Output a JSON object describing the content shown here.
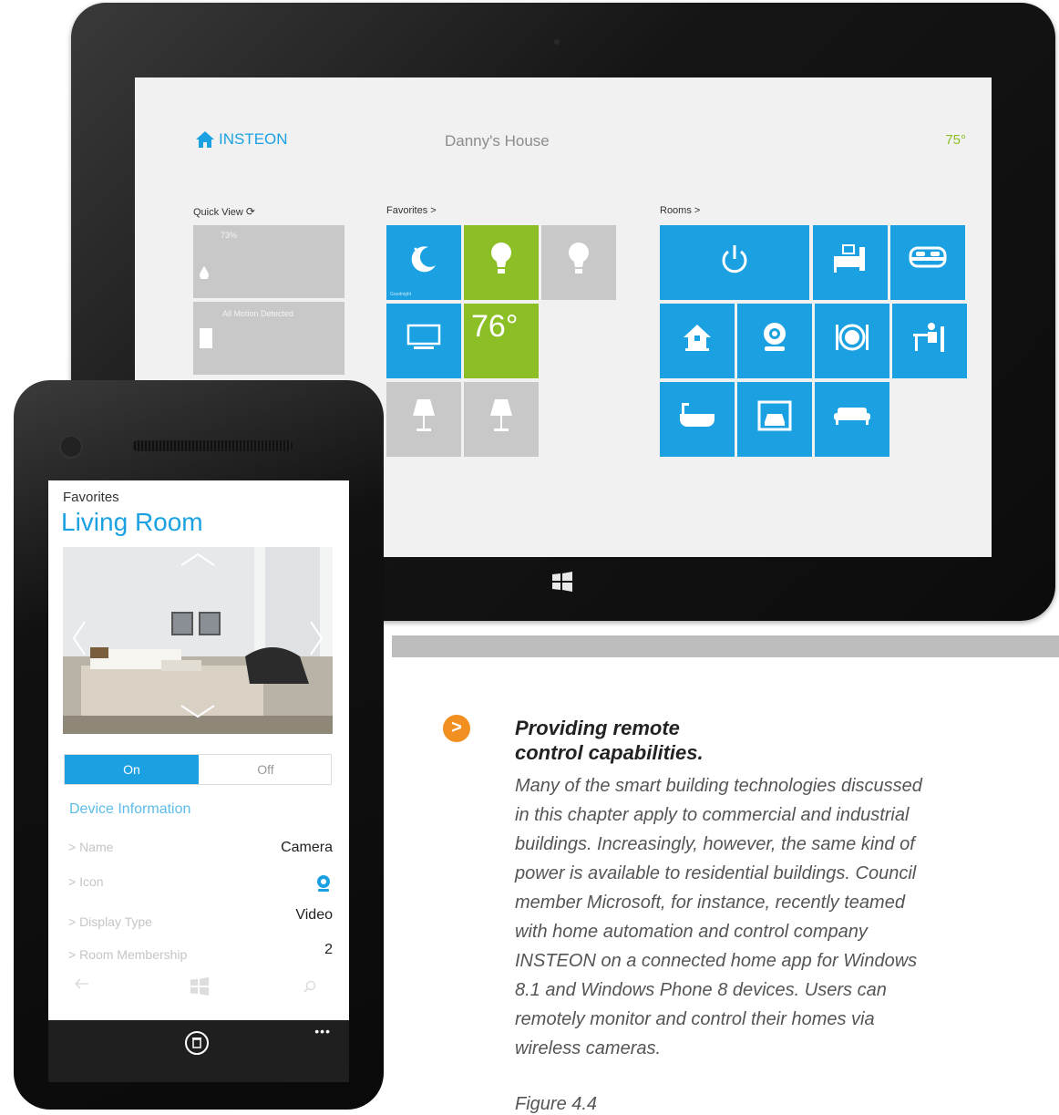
{
  "tablet": {
    "brand": "INSTEON",
    "house_name": "Danny's House",
    "temperature": "75°",
    "sections": {
      "quick_view": "Quick View",
      "favorites": "Favorites >",
      "rooms": "Rooms >"
    },
    "quick_view_items": [
      "73%",
      "All Motion Detected"
    ],
    "favorite_tiles": [
      {
        "icon": "moon-icon",
        "color": "blue"
      },
      {
        "icon": "lightbulb-icon",
        "color": "green"
      },
      {
        "icon": "lightbulb-icon",
        "color": "gray"
      },
      {
        "icon": "tv-icon",
        "color": "blue"
      },
      {
        "text": "76°",
        "color": "green"
      },
      {
        "icon": "lamp-icon",
        "color": "gray"
      },
      {
        "icon": "lamp-icon",
        "color": "gray"
      }
    ],
    "room_tiles": [
      {
        "icon": "power-icon"
      },
      {
        "icon": "bedroom-icon"
      },
      {
        "icon": "bed-icon"
      },
      {
        "icon": "house-icon"
      },
      {
        "icon": "camera-icon"
      },
      {
        "icon": "dining-icon"
      },
      {
        "icon": "office-icon"
      },
      {
        "icon": "bathtub-icon"
      },
      {
        "icon": "garage-icon"
      },
      {
        "icon": "sofa-icon"
      }
    ],
    "fav_temp": "76°"
  },
  "phone": {
    "breadcrumb": "Favorites",
    "title": "Living Room",
    "toggle_on": "On",
    "toggle_off": "Off",
    "section": "Device Information",
    "rows": [
      {
        "label": "> Name",
        "value": "Camera"
      },
      {
        "label": "> Icon",
        "value": ""
      },
      {
        "label": "> Display Type",
        "value": "Video"
      },
      {
        "label": "> Room Membership",
        "value": "2"
      }
    ],
    "more": "•••"
  },
  "article": {
    "bullet": ">",
    "heading_line1": "Providing remote",
    "heading_line2": "control capabilities.",
    "body": "Many of the smart building technologies discussed in this chapter apply to commercial and industrial buildings. Increasingly, however, the same kind of power is available to residential buildings. Council member Microsoft, for instance, recently teamed with home automation and control company INSTEON on a connected home app for Windows 8.1 and Windows Phone 8 devices. Users can remotely monitor and control their homes via wireless cameras.",
    "figure": "Figure 4.4"
  },
  "colors": {
    "accent_blue": "#1ba1e2",
    "accent_green": "#8cbf26",
    "tile_gray": "#c8c8c8",
    "bullet_orange": "#f18f21"
  }
}
